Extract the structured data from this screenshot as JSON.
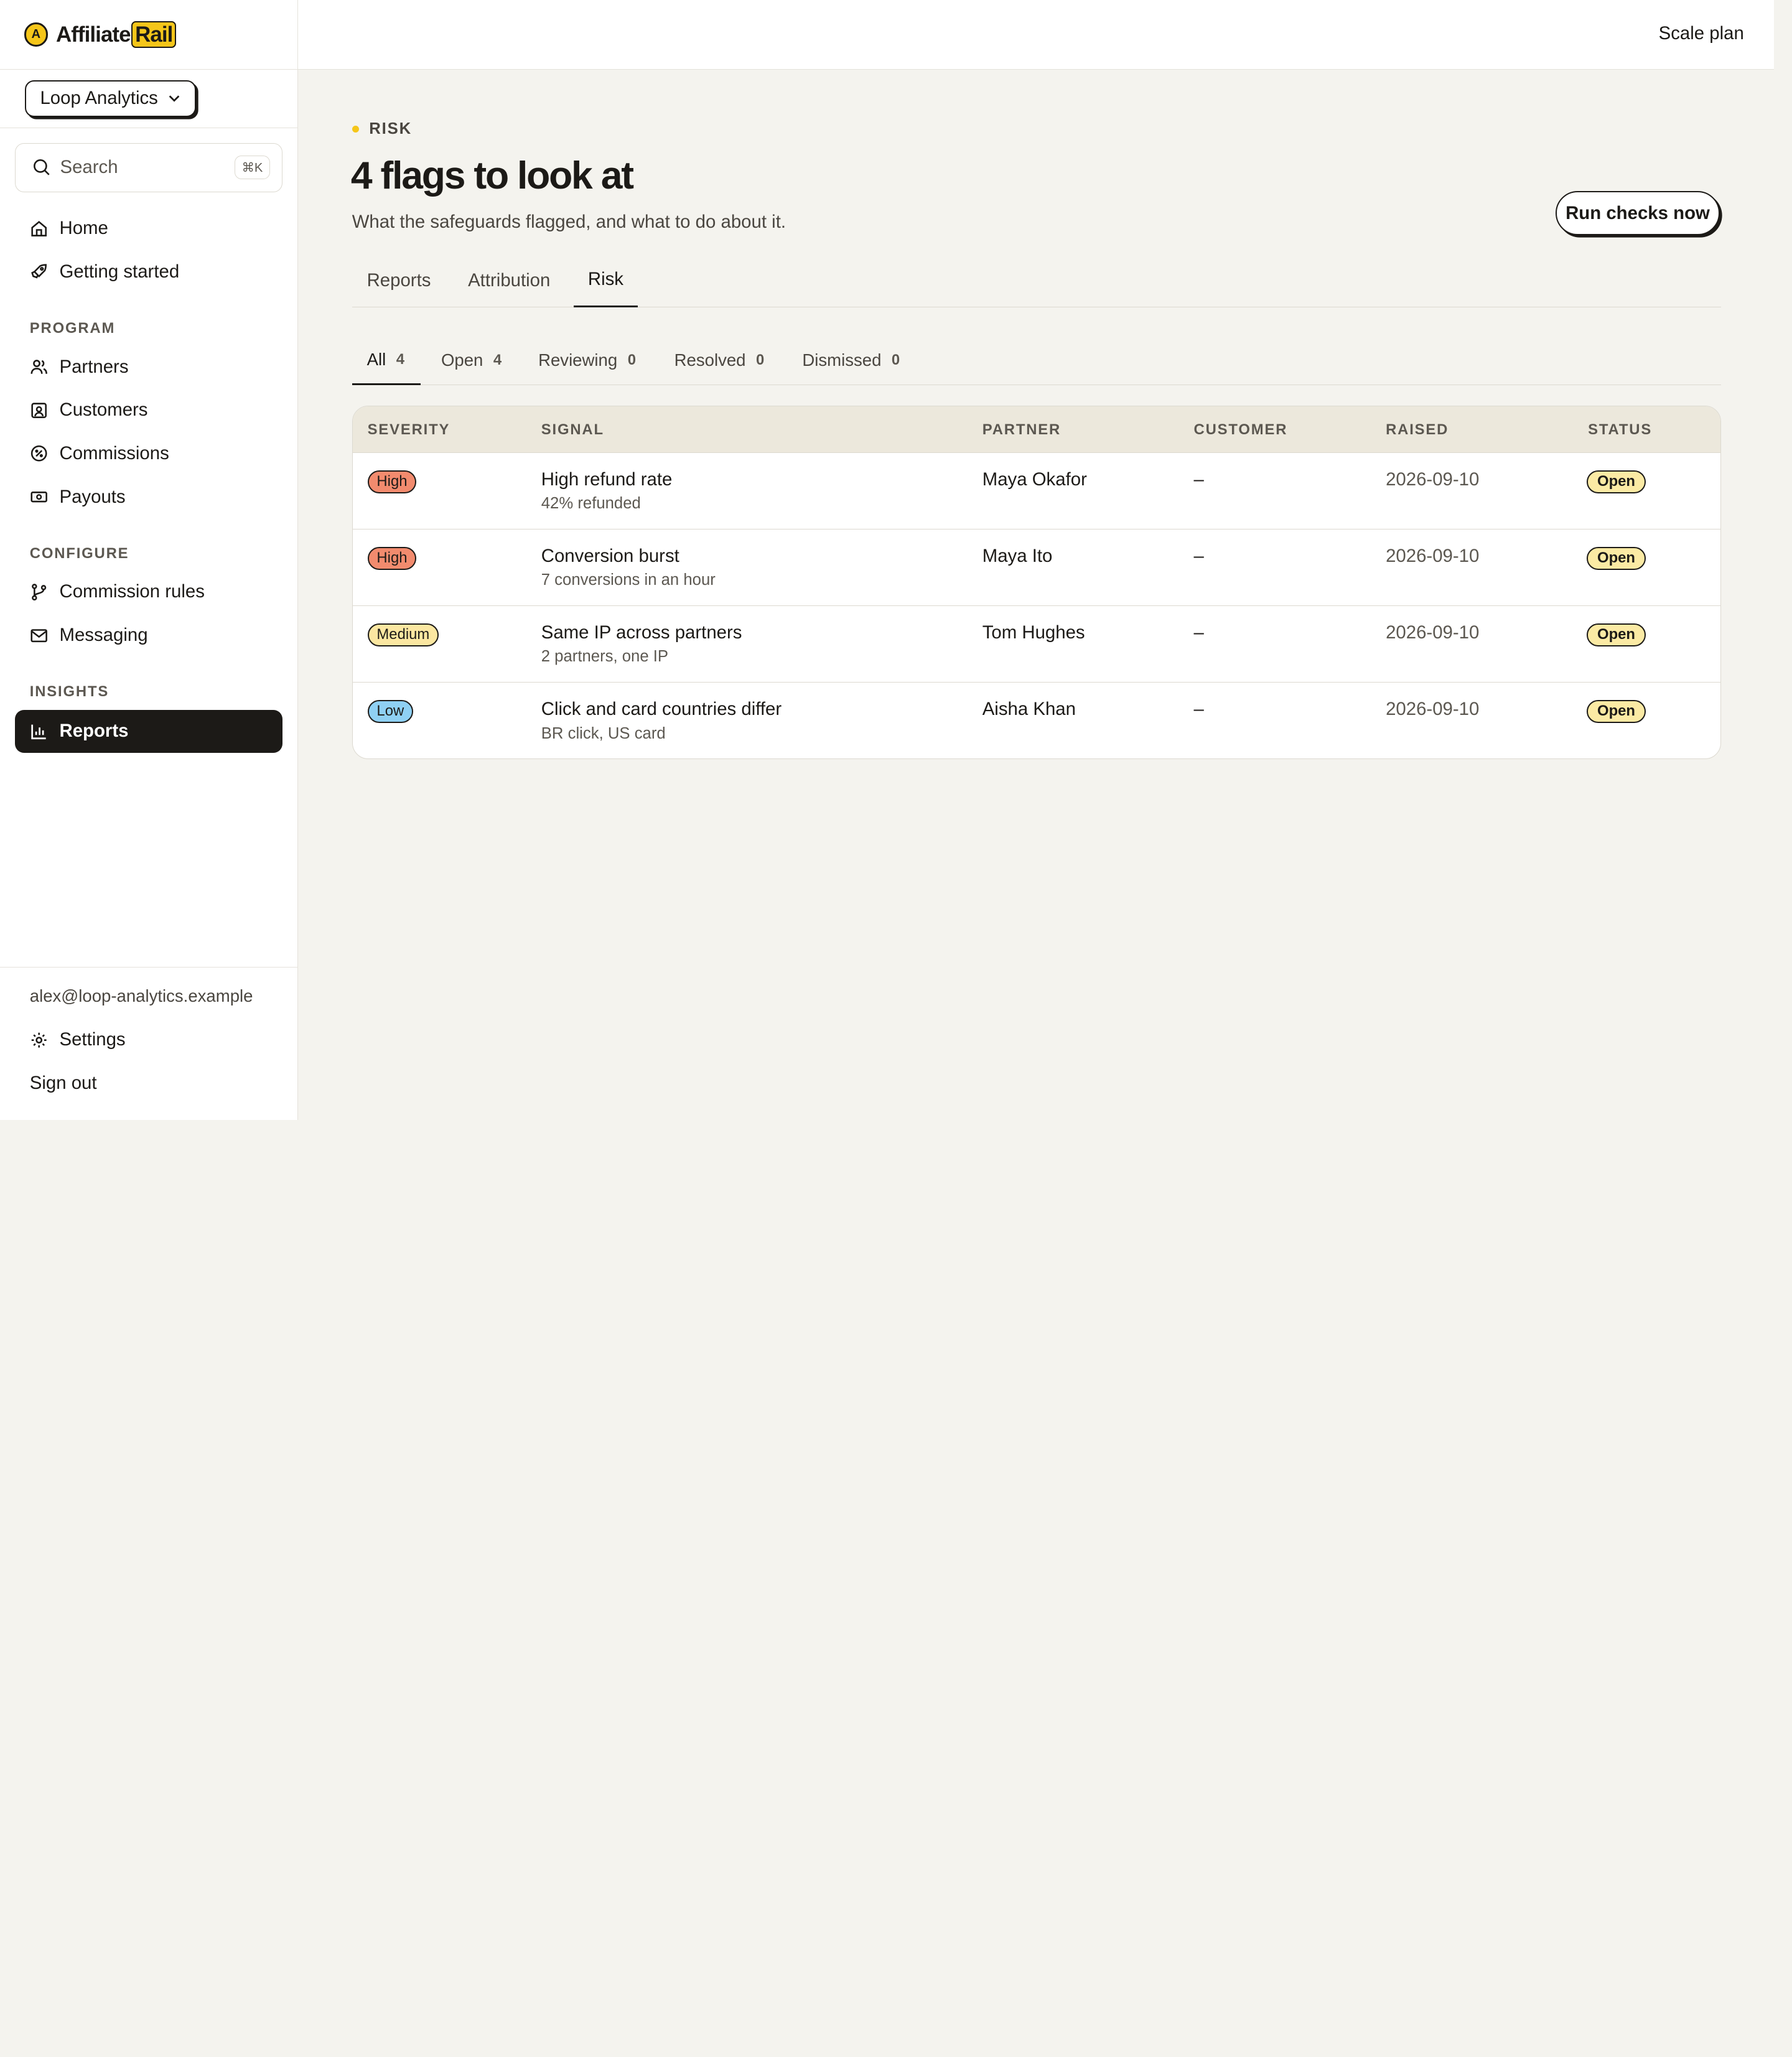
{
  "brand": {
    "name_prefix": "Affiliate",
    "name_suffix": "Rail",
    "mark": "A"
  },
  "org_switcher": {
    "label": "Loop Analytics",
    "icon": "chevron-down-icon"
  },
  "search": {
    "placeholder": "Search",
    "shortcut": "⌘K"
  },
  "sidebar": {
    "top_items": [
      {
        "label": "Home",
        "icon": "home-icon"
      },
      {
        "label": "Getting started",
        "icon": "rocket-icon"
      }
    ],
    "sections": [
      {
        "label": "PROGRAM",
        "items": [
          {
            "label": "Partners",
            "icon": "users-icon"
          },
          {
            "label": "Customers",
            "icon": "contact-icon"
          },
          {
            "label": "Commissions",
            "icon": "percent-icon"
          },
          {
            "label": "Payouts",
            "icon": "banknote-icon"
          }
        ]
      },
      {
        "label": "CONFIGURE",
        "items": [
          {
            "label": "Commission rules",
            "icon": "branch-icon"
          },
          {
            "label": "Messaging",
            "icon": "mail-icon"
          }
        ]
      },
      {
        "label": "INSIGHTS",
        "items": [
          {
            "label": "Reports",
            "icon": "bar-chart-icon",
            "active": true
          }
        ]
      }
    ],
    "footer": {
      "email": "alex@loop-analytics.example",
      "settings": "Settings",
      "sign_out": "Sign out"
    }
  },
  "topbar": {
    "plan": "Scale plan"
  },
  "page": {
    "eyebrow": "RISK",
    "title": "4 flags to look at",
    "subtitle": "What the safeguards flagged, and what to do about it.",
    "run_button": "Run checks now",
    "tabs": [
      {
        "label": "Reports"
      },
      {
        "label": "Attribution"
      },
      {
        "label": "Risk",
        "active": true
      }
    ],
    "filters": [
      {
        "label": "All",
        "count": "4",
        "active": true
      },
      {
        "label": "Open",
        "count": "4"
      },
      {
        "label": "Reviewing",
        "count": "0"
      },
      {
        "label": "Resolved",
        "count": "0"
      },
      {
        "label": "Dismissed",
        "count": "0"
      }
    ]
  },
  "table": {
    "columns": [
      "SEVERITY",
      "SIGNAL",
      "PARTNER",
      "CUSTOMER",
      "RAISED",
      "STATUS"
    ],
    "rows": [
      {
        "severity": "High",
        "signal": "High refund rate",
        "detail": "42% refunded",
        "partner": "Maya Okafor",
        "customer": "–",
        "raised": "2026-09-10",
        "status": "Open"
      },
      {
        "severity": "High",
        "signal": "Conversion burst",
        "detail": "7 conversions in an hour",
        "partner": "Maya Ito",
        "customer": "–",
        "raised": "2026-09-10",
        "status": "Open"
      },
      {
        "severity": "Medium",
        "signal": "Same IP across partners",
        "detail": "2 partners, one IP",
        "partner": "Tom Hughes",
        "customer": "–",
        "raised": "2026-09-10",
        "status": "Open"
      },
      {
        "severity": "Low",
        "signal": "Click and card countries differ",
        "detail": "BR click, US card",
        "partner": "Aisha Khan",
        "customer": "–",
        "raised": "2026-09-10",
        "status": "Open"
      }
    ]
  },
  "colors": {
    "accent": "#f5c61a",
    "severity_high": "#f28b6e",
    "severity_medium": "#fbe7a1",
    "severity_low": "#8fd0f3",
    "status_open": "#fbeaa4"
  }
}
